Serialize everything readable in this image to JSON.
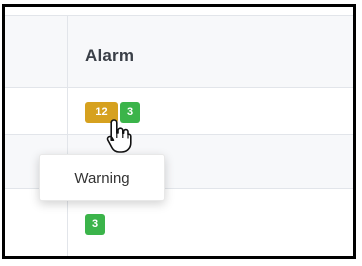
{
  "table": {
    "columns": [
      {
        "label": ""
      },
      {
        "label": "Alarm"
      }
    ],
    "rows": [
      {
        "badges": [
          {
            "value": "12",
            "status": "warning"
          },
          {
            "value": "3",
            "status": "ok"
          }
        ]
      },
      {
        "badges": []
      },
      {
        "badges": [
          {
            "value": "3",
            "status": "ok"
          }
        ]
      }
    ]
  },
  "tooltip": {
    "text": "Warning"
  },
  "colors": {
    "warning": "#d6a11f",
    "ok": "#3bb44a",
    "header_bg": "#f7f8fa",
    "border": "#e2e5ea"
  },
  "icons": {
    "cursor": "hand-pointer-icon"
  }
}
